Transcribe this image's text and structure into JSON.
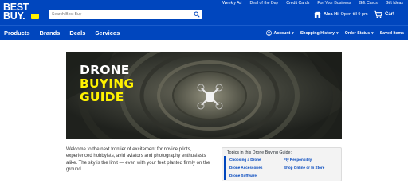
{
  "brand": {
    "logo_line1": "BEST",
    "logo_line2": "BUY.",
    "blue": "#0046be",
    "yellow": "#fff200"
  },
  "search": {
    "placeholder": "Search Best Buy"
  },
  "top_links": [
    "Weekly Ad",
    "Deal of the Day",
    "Credit Cards",
    "For Your Business",
    "Gift Cards",
    "Gift Ideas"
  ],
  "store": {
    "name": "Alea Hi",
    "hours": "Open till 9 pm"
  },
  "cart": {
    "label": "Cart"
  },
  "nav": {
    "main": [
      "Products",
      "Brands",
      "Deals",
      "Services"
    ],
    "account": "Account",
    "shopping_history": "Shopping History",
    "order_status": "Order Status",
    "saved_items": "Saved Items"
  },
  "hero": {
    "line1": "DRONE",
    "line2": "BUYING",
    "line3": "GUIDE"
  },
  "intro_text": "Welcome to the next frontier of excitement for novice pilots, experienced hobbyists, avid aviators and photography enthusiasts alike. The sky is the limit — even with your feet planted firmly on the ground.",
  "topics": {
    "title": "Topics in this Drone Buying Guide:",
    "links": [
      "Choosing a Drone",
      "Fly Responsibly",
      "Drone Accessories",
      "Shop Online or In Store",
      "Drone Software"
    ]
  }
}
